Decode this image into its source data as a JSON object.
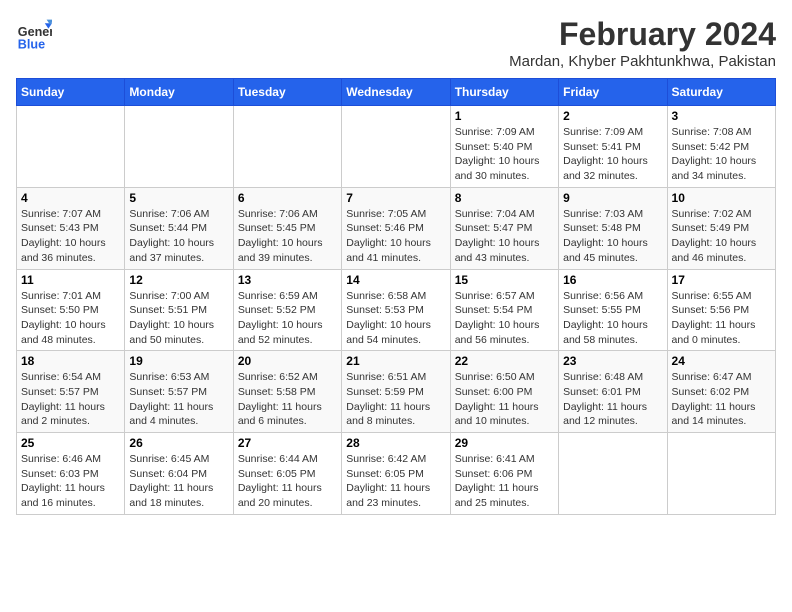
{
  "header": {
    "logo_line1": "General",
    "logo_line2": "Blue",
    "month_year": "February 2024",
    "location": "Mardan, Khyber Pakhtunkhwa, Pakistan"
  },
  "days_of_week": [
    "Sunday",
    "Monday",
    "Tuesday",
    "Wednesday",
    "Thursday",
    "Friday",
    "Saturday"
  ],
  "weeks": [
    [
      {
        "day": "",
        "info": ""
      },
      {
        "day": "",
        "info": ""
      },
      {
        "day": "",
        "info": ""
      },
      {
        "day": "",
        "info": ""
      },
      {
        "day": "1",
        "info": "Sunrise: 7:09 AM\nSunset: 5:40 PM\nDaylight: 10 hours and 30 minutes."
      },
      {
        "day": "2",
        "info": "Sunrise: 7:09 AM\nSunset: 5:41 PM\nDaylight: 10 hours and 32 minutes."
      },
      {
        "day": "3",
        "info": "Sunrise: 7:08 AM\nSunset: 5:42 PM\nDaylight: 10 hours and 34 minutes."
      }
    ],
    [
      {
        "day": "4",
        "info": "Sunrise: 7:07 AM\nSunset: 5:43 PM\nDaylight: 10 hours and 36 minutes."
      },
      {
        "day": "5",
        "info": "Sunrise: 7:06 AM\nSunset: 5:44 PM\nDaylight: 10 hours and 37 minutes."
      },
      {
        "day": "6",
        "info": "Sunrise: 7:06 AM\nSunset: 5:45 PM\nDaylight: 10 hours and 39 minutes."
      },
      {
        "day": "7",
        "info": "Sunrise: 7:05 AM\nSunset: 5:46 PM\nDaylight: 10 hours and 41 minutes."
      },
      {
        "day": "8",
        "info": "Sunrise: 7:04 AM\nSunset: 5:47 PM\nDaylight: 10 hours and 43 minutes."
      },
      {
        "day": "9",
        "info": "Sunrise: 7:03 AM\nSunset: 5:48 PM\nDaylight: 10 hours and 45 minutes."
      },
      {
        "day": "10",
        "info": "Sunrise: 7:02 AM\nSunset: 5:49 PM\nDaylight: 10 hours and 46 minutes."
      }
    ],
    [
      {
        "day": "11",
        "info": "Sunrise: 7:01 AM\nSunset: 5:50 PM\nDaylight: 10 hours and 48 minutes."
      },
      {
        "day": "12",
        "info": "Sunrise: 7:00 AM\nSunset: 5:51 PM\nDaylight: 10 hours and 50 minutes."
      },
      {
        "day": "13",
        "info": "Sunrise: 6:59 AM\nSunset: 5:52 PM\nDaylight: 10 hours and 52 minutes."
      },
      {
        "day": "14",
        "info": "Sunrise: 6:58 AM\nSunset: 5:53 PM\nDaylight: 10 hours and 54 minutes."
      },
      {
        "day": "15",
        "info": "Sunrise: 6:57 AM\nSunset: 5:54 PM\nDaylight: 10 hours and 56 minutes."
      },
      {
        "day": "16",
        "info": "Sunrise: 6:56 AM\nSunset: 5:55 PM\nDaylight: 10 hours and 58 minutes."
      },
      {
        "day": "17",
        "info": "Sunrise: 6:55 AM\nSunset: 5:56 PM\nDaylight: 11 hours and 0 minutes."
      }
    ],
    [
      {
        "day": "18",
        "info": "Sunrise: 6:54 AM\nSunset: 5:57 PM\nDaylight: 11 hours and 2 minutes."
      },
      {
        "day": "19",
        "info": "Sunrise: 6:53 AM\nSunset: 5:57 PM\nDaylight: 11 hours and 4 minutes."
      },
      {
        "day": "20",
        "info": "Sunrise: 6:52 AM\nSunset: 5:58 PM\nDaylight: 11 hours and 6 minutes."
      },
      {
        "day": "21",
        "info": "Sunrise: 6:51 AM\nSunset: 5:59 PM\nDaylight: 11 hours and 8 minutes."
      },
      {
        "day": "22",
        "info": "Sunrise: 6:50 AM\nSunset: 6:00 PM\nDaylight: 11 hours and 10 minutes."
      },
      {
        "day": "23",
        "info": "Sunrise: 6:48 AM\nSunset: 6:01 PM\nDaylight: 11 hours and 12 minutes."
      },
      {
        "day": "24",
        "info": "Sunrise: 6:47 AM\nSunset: 6:02 PM\nDaylight: 11 hours and 14 minutes."
      }
    ],
    [
      {
        "day": "25",
        "info": "Sunrise: 6:46 AM\nSunset: 6:03 PM\nDaylight: 11 hours and 16 minutes."
      },
      {
        "day": "26",
        "info": "Sunrise: 6:45 AM\nSunset: 6:04 PM\nDaylight: 11 hours and 18 minutes."
      },
      {
        "day": "27",
        "info": "Sunrise: 6:44 AM\nSunset: 6:05 PM\nDaylight: 11 hours and 20 minutes."
      },
      {
        "day": "28",
        "info": "Sunrise: 6:42 AM\nSunset: 6:05 PM\nDaylight: 11 hours and 23 minutes."
      },
      {
        "day": "29",
        "info": "Sunrise: 6:41 AM\nSunset: 6:06 PM\nDaylight: 11 hours and 25 minutes."
      },
      {
        "day": "",
        "info": ""
      },
      {
        "day": "",
        "info": ""
      }
    ]
  ]
}
